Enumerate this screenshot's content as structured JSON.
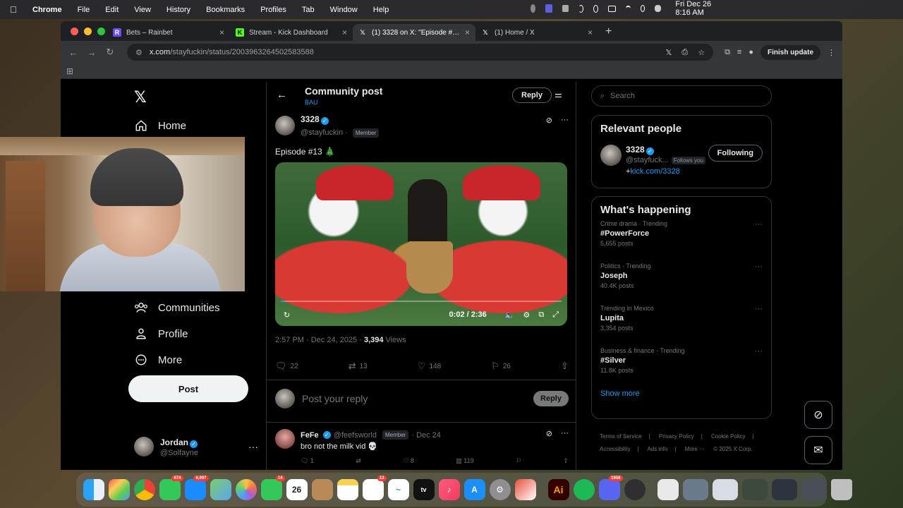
{
  "menubar": {
    "app": "Chrome",
    "items": [
      "File",
      "Edit",
      "View",
      "History",
      "Bookmarks",
      "Profiles",
      "Tab",
      "Window",
      "Help"
    ],
    "clock": "Fri Dec 26  8:16 AM"
  },
  "tabs": [
    {
      "title": "Bets – Rainbet",
      "icon": "rainbet-icon",
      "color": "#6c4cf5"
    },
    {
      "title": "Stream - Kick Dashboard",
      "icon": "kick-icon",
      "color": "#53fc18"
    },
    {
      "title": "(1) 3328 on X: \"Episode #13 🎄",
      "icon": "x-icon",
      "color": "#ffffff"
    },
    {
      "title": "(1) Home / X",
      "icon": "x-icon",
      "color": "#ffffff"
    }
  ],
  "omnibox": {
    "host": "x.com",
    "path": "/stayfuckin/status/2003963264502583588"
  },
  "toolbar": {
    "finish_update": "Finish update"
  },
  "leftnav": {
    "home": "Home",
    "communities": "Communities",
    "profile": "Profile",
    "more": "More",
    "post": "Post",
    "account_name": "Jordan",
    "account_handle": "@Solfayne"
  },
  "header": {
    "title": "Community post",
    "subtitle": "BAU",
    "reply": "Reply"
  },
  "tweet": {
    "author": "3328",
    "handle": "@stayfuckin",
    "badge": "Member",
    "text": "Episode #13 🎄",
    "video_time": "0:02 / 2:36",
    "video_progress": 0.013,
    "timestamp": "2:57 PM · Dec 24, 2025 · ",
    "views": "3,394",
    "views_label": "Views",
    "replies": "22",
    "reposts": "13",
    "likes": "148",
    "bookmarks": "26"
  },
  "reply_box": {
    "placeholder": "Post your reply",
    "button": "Reply"
  },
  "comment": {
    "name": "FeFe",
    "handle": "@feefsworld",
    "badge": "Member",
    "date": "· Dec 24",
    "text": "bro  not the milk vid 💀",
    "replies": "1",
    "likes": "8",
    "views": "119"
  },
  "right": {
    "search_placeholder": "Search",
    "relevant_title": "Relevant people",
    "rp_name": "3328",
    "rp_handle": "@stayfuck...",
    "rp_follows": "Follows you",
    "rp_link": "kick.com/3328",
    "rp_follow_btn": "Following",
    "happening_title": "What's happening",
    "trends": [
      {
        "context": "Crime drama · Trending",
        "name": "#PowerForce",
        "posts": "5,655 posts"
      },
      {
        "context": "Politics · Trending",
        "name": "Joseph",
        "posts": "40.4K posts"
      },
      {
        "context": "Trending in Mexico",
        "name": "Lupita",
        "posts": "3,354 posts"
      },
      {
        "context": "Business & finance · Trending",
        "name": "#Silver",
        "posts": "11.8K posts"
      }
    ],
    "show_more": "Show more",
    "footer": [
      "Terms of Service",
      "|",
      "Privacy Policy",
      "|",
      "Cookie Policy",
      "|",
      "Accessibility",
      "|",
      "Ads info",
      "|",
      "More ···",
      "© 2025 X Corp."
    ]
  },
  "dock": {
    "badges": {
      "messages": "674",
      "mail": "6,997",
      "facetime": "14",
      "reminders": "13",
      "discord": "1958"
    },
    "calendar_day": "26",
    "apps": [
      "finder",
      "launchpad",
      "chrome",
      "messages",
      "mail",
      "maps",
      "photos",
      "facetime",
      "calendar",
      "contacts",
      "notes",
      "reminders",
      "freeform",
      "tv",
      "music",
      "app-store",
      "settings",
      "preview",
      "illustrator",
      "spotify",
      "discord",
      "obs"
    ]
  }
}
